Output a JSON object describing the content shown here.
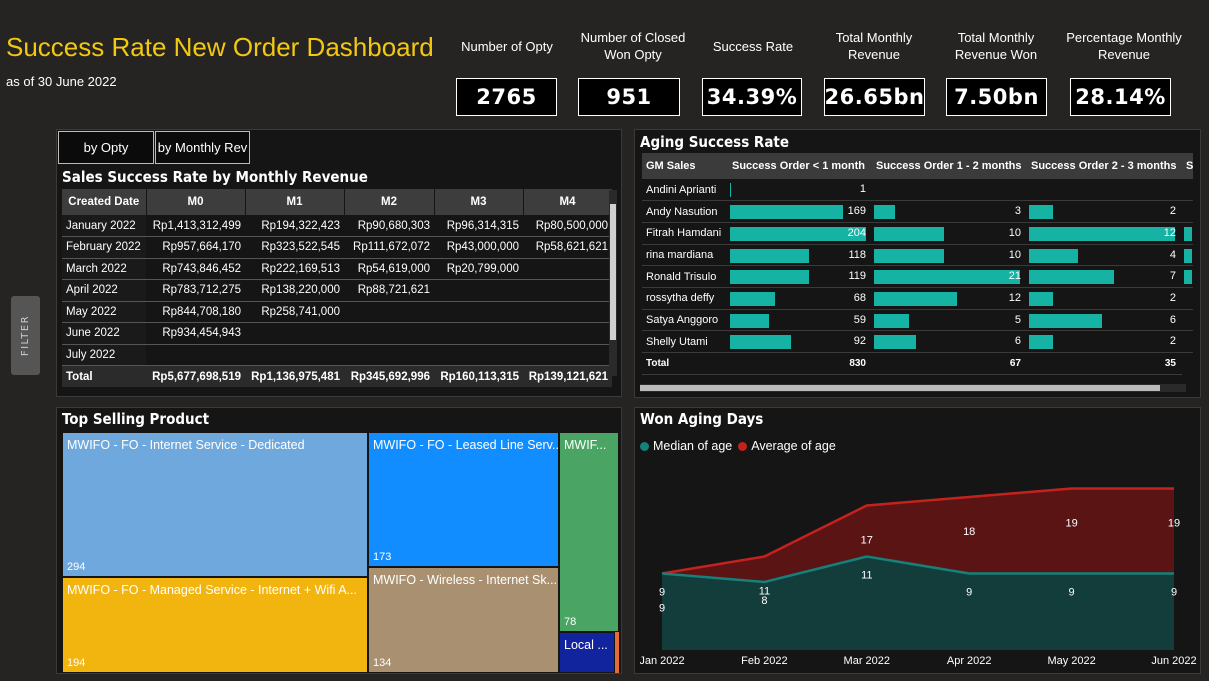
{
  "header": {
    "title": "Success Rate New Order Dashboard",
    "subtitle": "as of 30 June 2022"
  },
  "kpis": [
    {
      "label": "Number of Opty",
      "value": "2765"
    },
    {
      "label": "Number of Closed Won Opty",
      "value": "951"
    },
    {
      "label": "Success Rate",
      "value": "34.39%"
    },
    {
      "label": "Total Monthly Revenue",
      "value": "26.65bn"
    },
    {
      "label": "Total Monthly Revenue Won",
      "value": "7.50bn"
    },
    {
      "label": "Percentage Monthly Revenue",
      "value": "28.14%"
    }
  ],
  "filter_pane": {
    "label": "FILTER"
  },
  "sales": {
    "tabs": [
      "by Opty",
      "by Monthly Rev"
    ],
    "title": "Sales Success Rate by Monthly Revenue",
    "columns": [
      "Created Date",
      "M0",
      "M1",
      "M2",
      "M3",
      "M4"
    ],
    "rows": [
      [
        "January 2022",
        "Rp1,413,312,499",
        "Rp194,322,423",
        "Rp90,680,303",
        "Rp96,314,315",
        "Rp80,500,000"
      ],
      [
        "February 2022",
        "Rp957,664,170",
        "Rp323,522,545",
        "Rp111,672,072",
        "Rp43,000,000",
        "Rp58,621,621"
      ],
      [
        "March 2022",
        "Rp743,846,452",
        "Rp222,169,513",
        "Rp54,619,000",
        "Rp20,799,000",
        ""
      ],
      [
        "April 2022",
        "Rp783,712,275",
        "Rp138,220,000",
        "Rp88,721,621",
        "",
        ""
      ],
      [
        "May 2022",
        "Rp844,708,180",
        "Rp258,741,000",
        "",
        "",
        ""
      ],
      [
        "June 2022",
        "Rp934,454,943",
        "",
        "",
        "",
        ""
      ],
      [
        "July 2022",
        "",
        "",
        "",
        "",
        ""
      ]
    ],
    "total": [
      "Total",
      "Rp5,677,698,519",
      "Rp1,136,975,481",
      "Rp345,692,996",
      "Rp160,113,315",
      "Rp139,121,621"
    ]
  },
  "aging": {
    "title": "Aging Success Rate",
    "columns": [
      "GM Sales",
      "Success Order < 1 month",
      "Success Order 1 - 2 months",
      "Success Order 2 - 3 months",
      "S"
    ],
    "rows": [
      {
        "name": "Andini Aprianti",
        "c1": 1,
        "c2": null,
        "c3": null,
        "c4": null
      },
      {
        "name": "Andy Nasution",
        "c1": 169,
        "c2": 3,
        "c3": 2,
        "c4": null
      },
      {
        "name": "Fitrah Hamdani",
        "c1": 204,
        "c2": 10,
        "c3": 12,
        "c4": 1
      },
      {
        "name": "rina mardiana",
        "c1": 118,
        "c2": 10,
        "c3": 4,
        "c4": 1
      },
      {
        "name": "Ronald Trisulo",
        "c1": 119,
        "c2": 21,
        "c3": 7,
        "c4": 1
      },
      {
        "name": "rossytha deffy",
        "c1": 68,
        "c2": 12,
        "c3": 2,
        "c4": null
      },
      {
        "name": "Satya Anggoro",
        "c1": 59,
        "c2": 5,
        "c3": 6,
        "c4": null
      },
      {
        "name": "Shelly Utami",
        "c1": 92,
        "c2": 6,
        "c3": 2,
        "c4": null
      }
    ],
    "total": {
      "name": "Total",
      "c1": "830",
      "c2": "67",
      "c3": "35"
    },
    "max": {
      "c1": 204,
      "c2": 21,
      "c3": 12
    },
    "bar_color": "#16b3a5"
  },
  "treemap": {
    "title": "Top Selling Product",
    "items": [
      {
        "label": "MWIFO - FO - Internet Service - Dedicated",
        "value": "294",
        "color": "#6fa8dc"
      },
      {
        "label": "MWIFO - FO - Leased Line Serv...",
        "value": "173",
        "color": "#118dff"
      },
      {
        "label": "MWIF...",
        "value": "78",
        "color": "#4aa564"
      },
      {
        "label": "MWIFO - FO - Managed Service - Internet + Wifi A...",
        "value": "194",
        "color": "#f2b50f"
      },
      {
        "label": "MWIFO - Wireless - Internet Sk...",
        "value": "134",
        "color": "#a89070"
      },
      {
        "label": "Local ...",
        "value": "",
        "color": "#12239e"
      }
    ]
  },
  "won_aging": {
    "title": "Won Aging Days",
    "legend": [
      "Median of age",
      "Average of age"
    ]
  },
  "chart_data": {
    "type": "area",
    "categories": [
      "Jan 2022",
      "Feb 2022",
      "Mar 2022",
      "Apr 2022",
      "May 2022",
      "Jun 2022"
    ],
    "series": [
      {
        "name": "Median of age",
        "values": [
          9,
          8,
          11,
          9,
          9,
          9
        ],
        "color": "#16807a"
      },
      {
        "name": "Average of age",
        "values": [
          9,
          11,
          17,
          18,
          19,
          19
        ],
        "color": "#c4221f"
      }
    ],
    "title": "Won Aging Days",
    "grid": false,
    "legend_position": "top-left"
  }
}
